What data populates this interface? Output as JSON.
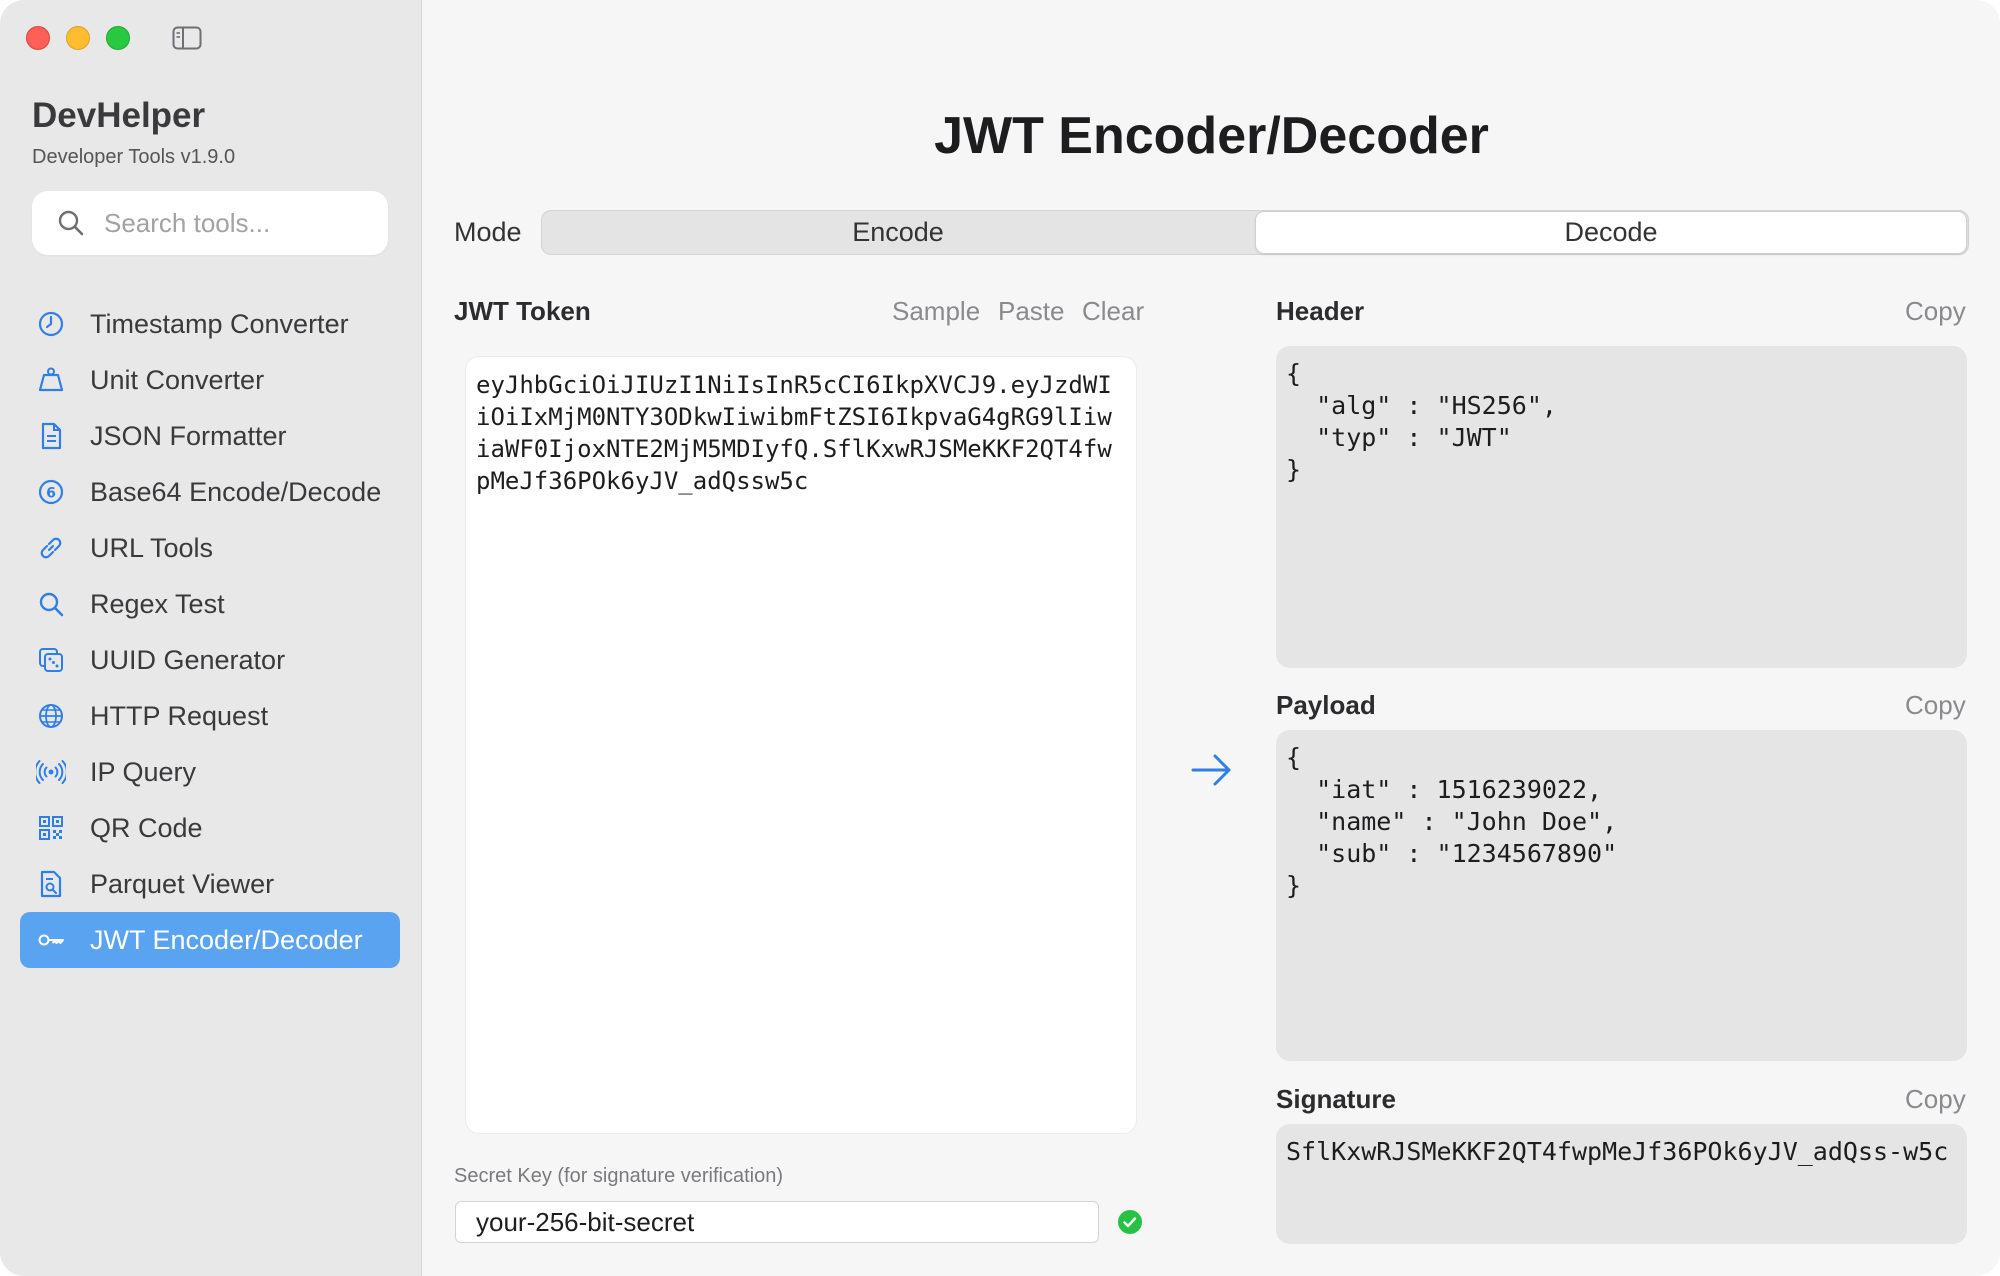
{
  "app": {
    "name": "DevHelper",
    "subtitle": "Developer Tools v1.9.0"
  },
  "search": {
    "placeholder": "Search tools..."
  },
  "sidebar": {
    "items": [
      {
        "label": "Timestamp Converter",
        "icon": "clock-icon"
      },
      {
        "label": "Unit Converter",
        "icon": "weight-icon"
      },
      {
        "label": "JSON Formatter",
        "icon": "document-icon"
      },
      {
        "label": "Base64 Encode/Decode",
        "icon": "six-circle-icon"
      },
      {
        "label": "URL Tools",
        "icon": "link-icon"
      },
      {
        "label": "Regex Test",
        "icon": "magnifier-icon"
      },
      {
        "label": "UUID Generator",
        "icon": "dice-icon"
      },
      {
        "label": "HTTP Request",
        "icon": "globe-icon"
      },
      {
        "label": "IP Query",
        "icon": "antenna-icon"
      },
      {
        "label": "QR Code",
        "icon": "qrcode-icon"
      },
      {
        "label": "Parquet Viewer",
        "icon": "doc-search-icon"
      },
      {
        "label": "JWT Encoder/Decoder",
        "icon": "key-icon",
        "active": true
      }
    ]
  },
  "main": {
    "title": "JWT Encoder/Decoder",
    "mode_label": "Mode",
    "modes": [
      "Encode",
      "Decode"
    ],
    "selected_mode": "Decode",
    "token_label": "JWT Token",
    "token_actions": {
      "sample": "Sample",
      "paste": "Paste",
      "clear": "Clear"
    },
    "token_value": "eyJhbGciOiJIUzI1NiIsInR5cCI6IkpXVCJ9.eyJzdWIiOiIxMjM0NTY3ODkwIiwibmFtZSI6IkpvaG4gRG9lIiwiaWF0IjoxNTE2MjM5MDIyfQ.SflKxwRJSMeKKF2QT4fwpMeJf36POk6yJV_adQssw5c",
    "secret_label": "Secret Key (for signature verification)",
    "secret_value": "your-256-bit-secret",
    "signature_valid": true,
    "header": {
      "label": "Header",
      "copy": "Copy",
      "content": "{\n  \"alg\" : \"HS256\",\n  \"typ\" : \"JWT\"\n}"
    },
    "payload": {
      "label": "Payload",
      "copy": "Copy",
      "content": "{\n  \"iat\" : 1516239022,\n  \"name\" : \"John Doe\",\n  \"sub\" : \"1234567890\"\n}"
    },
    "signature": {
      "label": "Signature",
      "copy": "Copy",
      "content": "SflKxwRJSMeKKF2QT4fwpMeJf36POk6yJV_adQss-w5c"
    }
  },
  "colors": {
    "accent": "#5aa3f0",
    "icon_blue": "#2f7fe6",
    "valid_green": "#27c244"
  }
}
